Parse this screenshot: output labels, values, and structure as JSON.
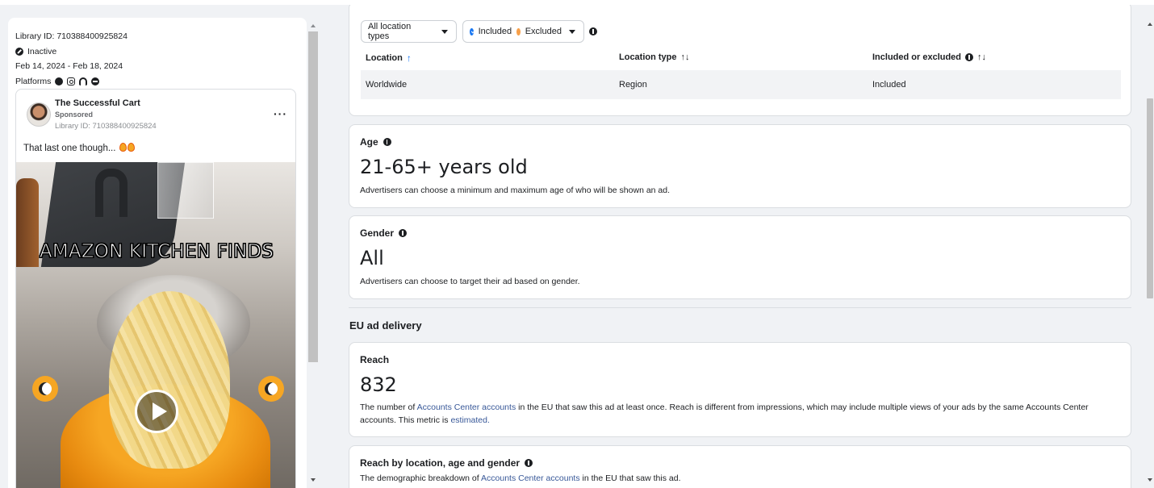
{
  "ad": {
    "library_id": "Library ID: 710388400925824",
    "status": "Inactive",
    "date_range": "Feb 14, 2024 - Feb 18, 2024",
    "platforms_label": "Platforms",
    "platforms": [
      "facebook-icon",
      "instagram-icon",
      "audience-network-icon",
      "messenger-icon"
    ],
    "advertiser": "The Successful Cart",
    "sponsored": "Sponsored",
    "card_library_id": "Library ID: 710388400925824",
    "more": "···",
    "body_text": "That last one though...",
    "video_overlay_text": "AMAZON KITCHEN FINDS"
  },
  "filters": {
    "location_types": "All location types",
    "included": "Included",
    "excluded": "Excluded"
  },
  "location_table": {
    "headers": {
      "location": "Location",
      "location_sort": "↑",
      "type": "Location type",
      "type_sort": "↑↓",
      "included": "Included or excluded",
      "included_sort": "↑↓"
    },
    "rows": [
      {
        "location": "Worldwide",
        "type": "Region",
        "status": "Included"
      }
    ]
  },
  "age": {
    "label": "Age",
    "value": "21-65+ years old",
    "description": "Advertisers can choose a minimum and maximum age of who will be shown an ad."
  },
  "gender": {
    "label": "Gender",
    "value": "All",
    "description": "Advertisers can choose to target their ad based on gender."
  },
  "eu_delivery": {
    "title": "EU ad delivery",
    "reach": {
      "label": "Reach",
      "value": "832",
      "desc_1": "The number of ",
      "link_1": "Accounts Center accounts",
      "desc_2": " in the EU that saw this ad at least once. Reach is different from impressions, which may include multiple views of your ads by the same Accounts Center accounts. This metric is ",
      "link_2": "estimated.",
      "desc_3": ""
    },
    "breakdown": {
      "label": "Reach by location, age and gender",
      "desc_1": "The demographic breakdown of ",
      "link_1": "Accounts Center accounts",
      "desc_2": " in the EU that saw this ad."
    }
  },
  "colors": {
    "link": "#385898",
    "accent": "#1877f2",
    "excluded_dot": "#f7a04a",
    "row_bg": "#f2f3f5"
  }
}
